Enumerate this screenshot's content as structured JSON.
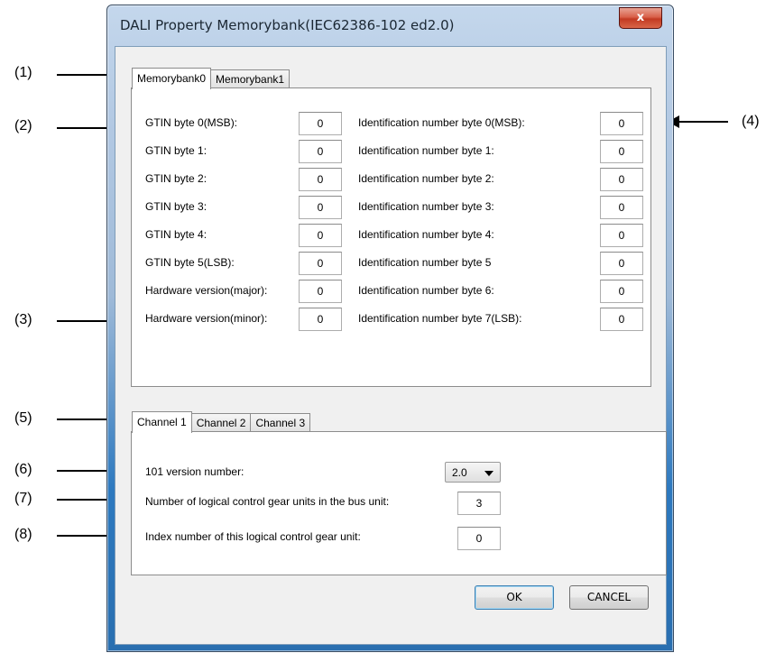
{
  "window": {
    "title": "DALI Property Memorybank(IEC62386-102 ed2.0)",
    "close_label": "x"
  },
  "callouts": [
    "(1)",
    "(2)",
    "(3)",
    "(4)",
    "(5)",
    "(6)",
    "(7)",
    "(8)"
  ],
  "memorybank_tabs": [
    "Memorybank0",
    "Memorybank1"
  ],
  "gtin_rows": [
    {
      "label": "GTIN byte 0(MSB):",
      "value": "0"
    },
    {
      "label": "GTIN byte 1:",
      "value": "0"
    },
    {
      "label": "GTIN byte 2:",
      "value": "0"
    },
    {
      "label": "GTIN byte 3:",
      "value": "0"
    },
    {
      "label": "GTIN byte 4:",
      "value": "0"
    },
    {
      "label": "GTIN byte 5(LSB):",
      "value": "0"
    },
    {
      "label": "Hardware version(major):",
      "value": "0"
    },
    {
      "label": "Hardware version(minor):",
      "value": "0"
    }
  ],
  "id_rows": [
    {
      "label": "Identification number byte 0(MSB):",
      "value": "0"
    },
    {
      "label": "Identification number byte 1:",
      "value": "0"
    },
    {
      "label": "Identification number byte 2:",
      "value": "0"
    },
    {
      "label": "Identification number byte 3:",
      "value": "0"
    },
    {
      "label": "Identification number byte 4:",
      "value": "0"
    },
    {
      "label": "Identification number byte 5",
      "value": "0"
    },
    {
      "label": "Identification number byte 6:",
      "value": "0"
    },
    {
      "label": "Identification number byte 7(LSB):",
      "value": "0"
    }
  ],
  "channel_tabs": [
    "Channel 1",
    "Channel 2",
    "Channel 3"
  ],
  "channel": {
    "version_label": "101 version number:",
    "version_value": "2.0",
    "units_label": "Number of logical control gear units in the bus unit:",
    "units_value": "3",
    "index_label": "Index number of this logical control gear unit:",
    "index_value": "0"
  },
  "buttons": {
    "ok": "OK",
    "cancel": "CANCEL"
  }
}
